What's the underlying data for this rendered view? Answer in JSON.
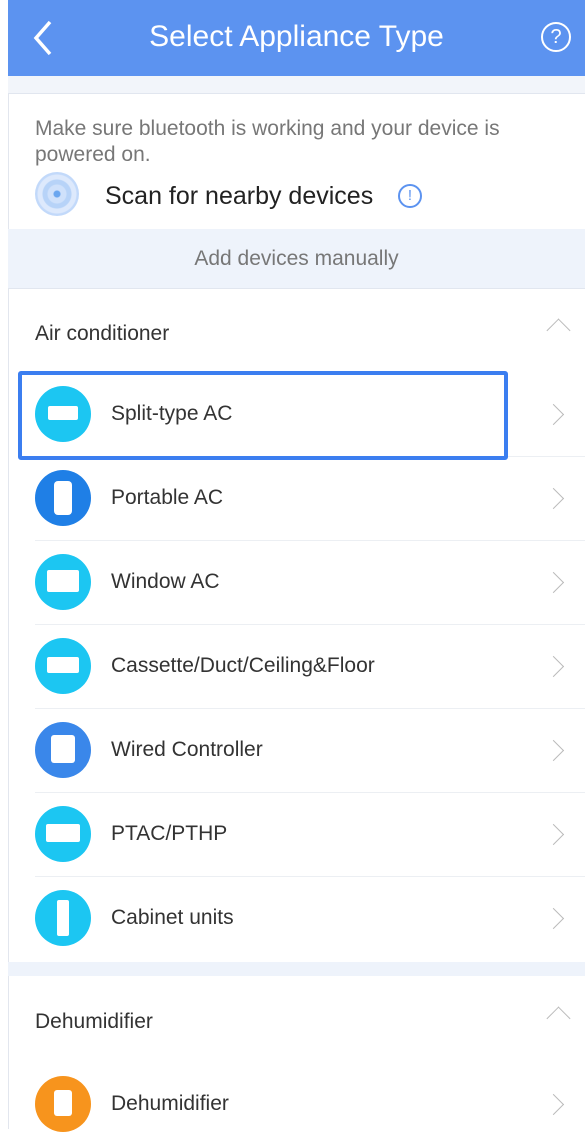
{
  "header": {
    "title": "Select Appliance Type",
    "help_glyph": "?"
  },
  "scan": {
    "hint": "Make sure bluetooth is working and your device is powered on.",
    "label": "Scan for nearby devices",
    "info_glyph": "!"
  },
  "manual": {
    "label": "Add devices manually"
  },
  "sections": [
    {
      "label": "Air conditioner",
      "items": [
        {
          "label": "Split-type AC",
          "icon": "split-ac-icon",
          "color": "#1cc6f2"
        },
        {
          "label": "Portable AC",
          "icon": "portable-ac-icon",
          "color": "#1f7fe6"
        },
        {
          "label": "Window AC",
          "icon": "window-ac-icon",
          "color": "#1cc6f2"
        },
        {
          "label": "Cassette/Duct/Ceiling&Floor",
          "icon": "cassette-ac-icon",
          "color": "#1cc6f2"
        },
        {
          "label": "Wired Controller",
          "icon": "wired-controller-icon",
          "color": "#3a87ea"
        },
        {
          "label": "PTAC/PTHP",
          "icon": "ptac-icon",
          "color": "#1cc6f2"
        },
        {
          "label": "Cabinet units",
          "icon": "cabinet-unit-icon",
          "color": "#1cc6f2"
        }
      ]
    },
    {
      "label": "Dehumidifier",
      "items": [
        {
          "label": "Dehumidifier",
          "icon": "dehumidifier-icon",
          "color": "#f7941d"
        }
      ]
    }
  ],
  "colors": {
    "accent": "#5c93f0",
    "highlight": "#3b7ef0"
  }
}
